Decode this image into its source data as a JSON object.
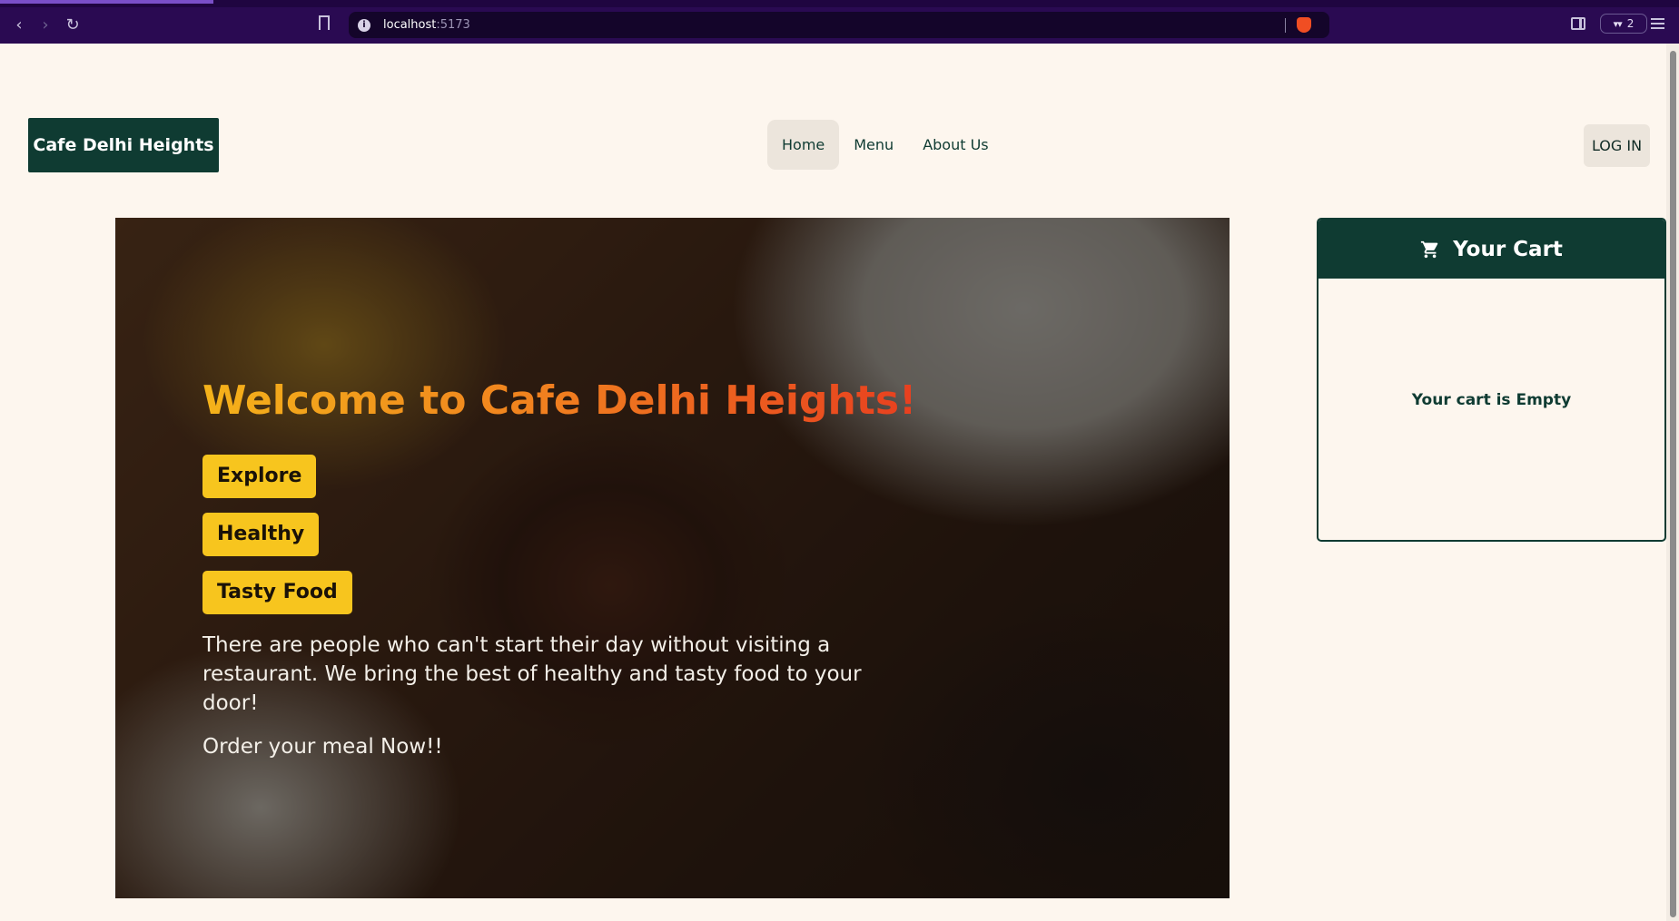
{
  "browser": {
    "url_host": "localhost",
    "url_port": ":5173",
    "wallet_count": "2",
    "icons": [
      "back-icon",
      "forward-icon",
      "reload-icon",
      "bookmark-icon",
      "info-icon",
      "brave-shield-icon",
      "sidebar-icon",
      "wallet-icon",
      "menu-icon"
    ]
  },
  "header": {
    "logo": "Cafe Delhi Heights",
    "nav": [
      {
        "label": "Home",
        "active": true
      },
      {
        "label": "Menu",
        "active": false
      },
      {
        "label": "About Us",
        "active": false
      }
    ],
    "login_label": "LOG IN"
  },
  "hero": {
    "title": "Welcome to Cafe Delhi Heights!!",
    "tags": [
      "Explore",
      "Healthy",
      "Tasty Food"
    ],
    "description": "There are people who can't start their day without visiting a restaurant. We bring the best of healthy and tasty food to your door!",
    "cta": "Order your meal Now!!"
  },
  "cart": {
    "title": "Your Cart",
    "empty_message": "Your cart is Empty",
    "icon": "cart-icon"
  },
  "colors": {
    "brand_dark": "#0f3b32",
    "page_bg": "#fdf6ee",
    "tag_yellow": "#f7c51e",
    "title_gradient": [
      "#f4b21a",
      "#f07e1f",
      "#e8401f"
    ],
    "browser_bar": "#2a0a52"
  }
}
